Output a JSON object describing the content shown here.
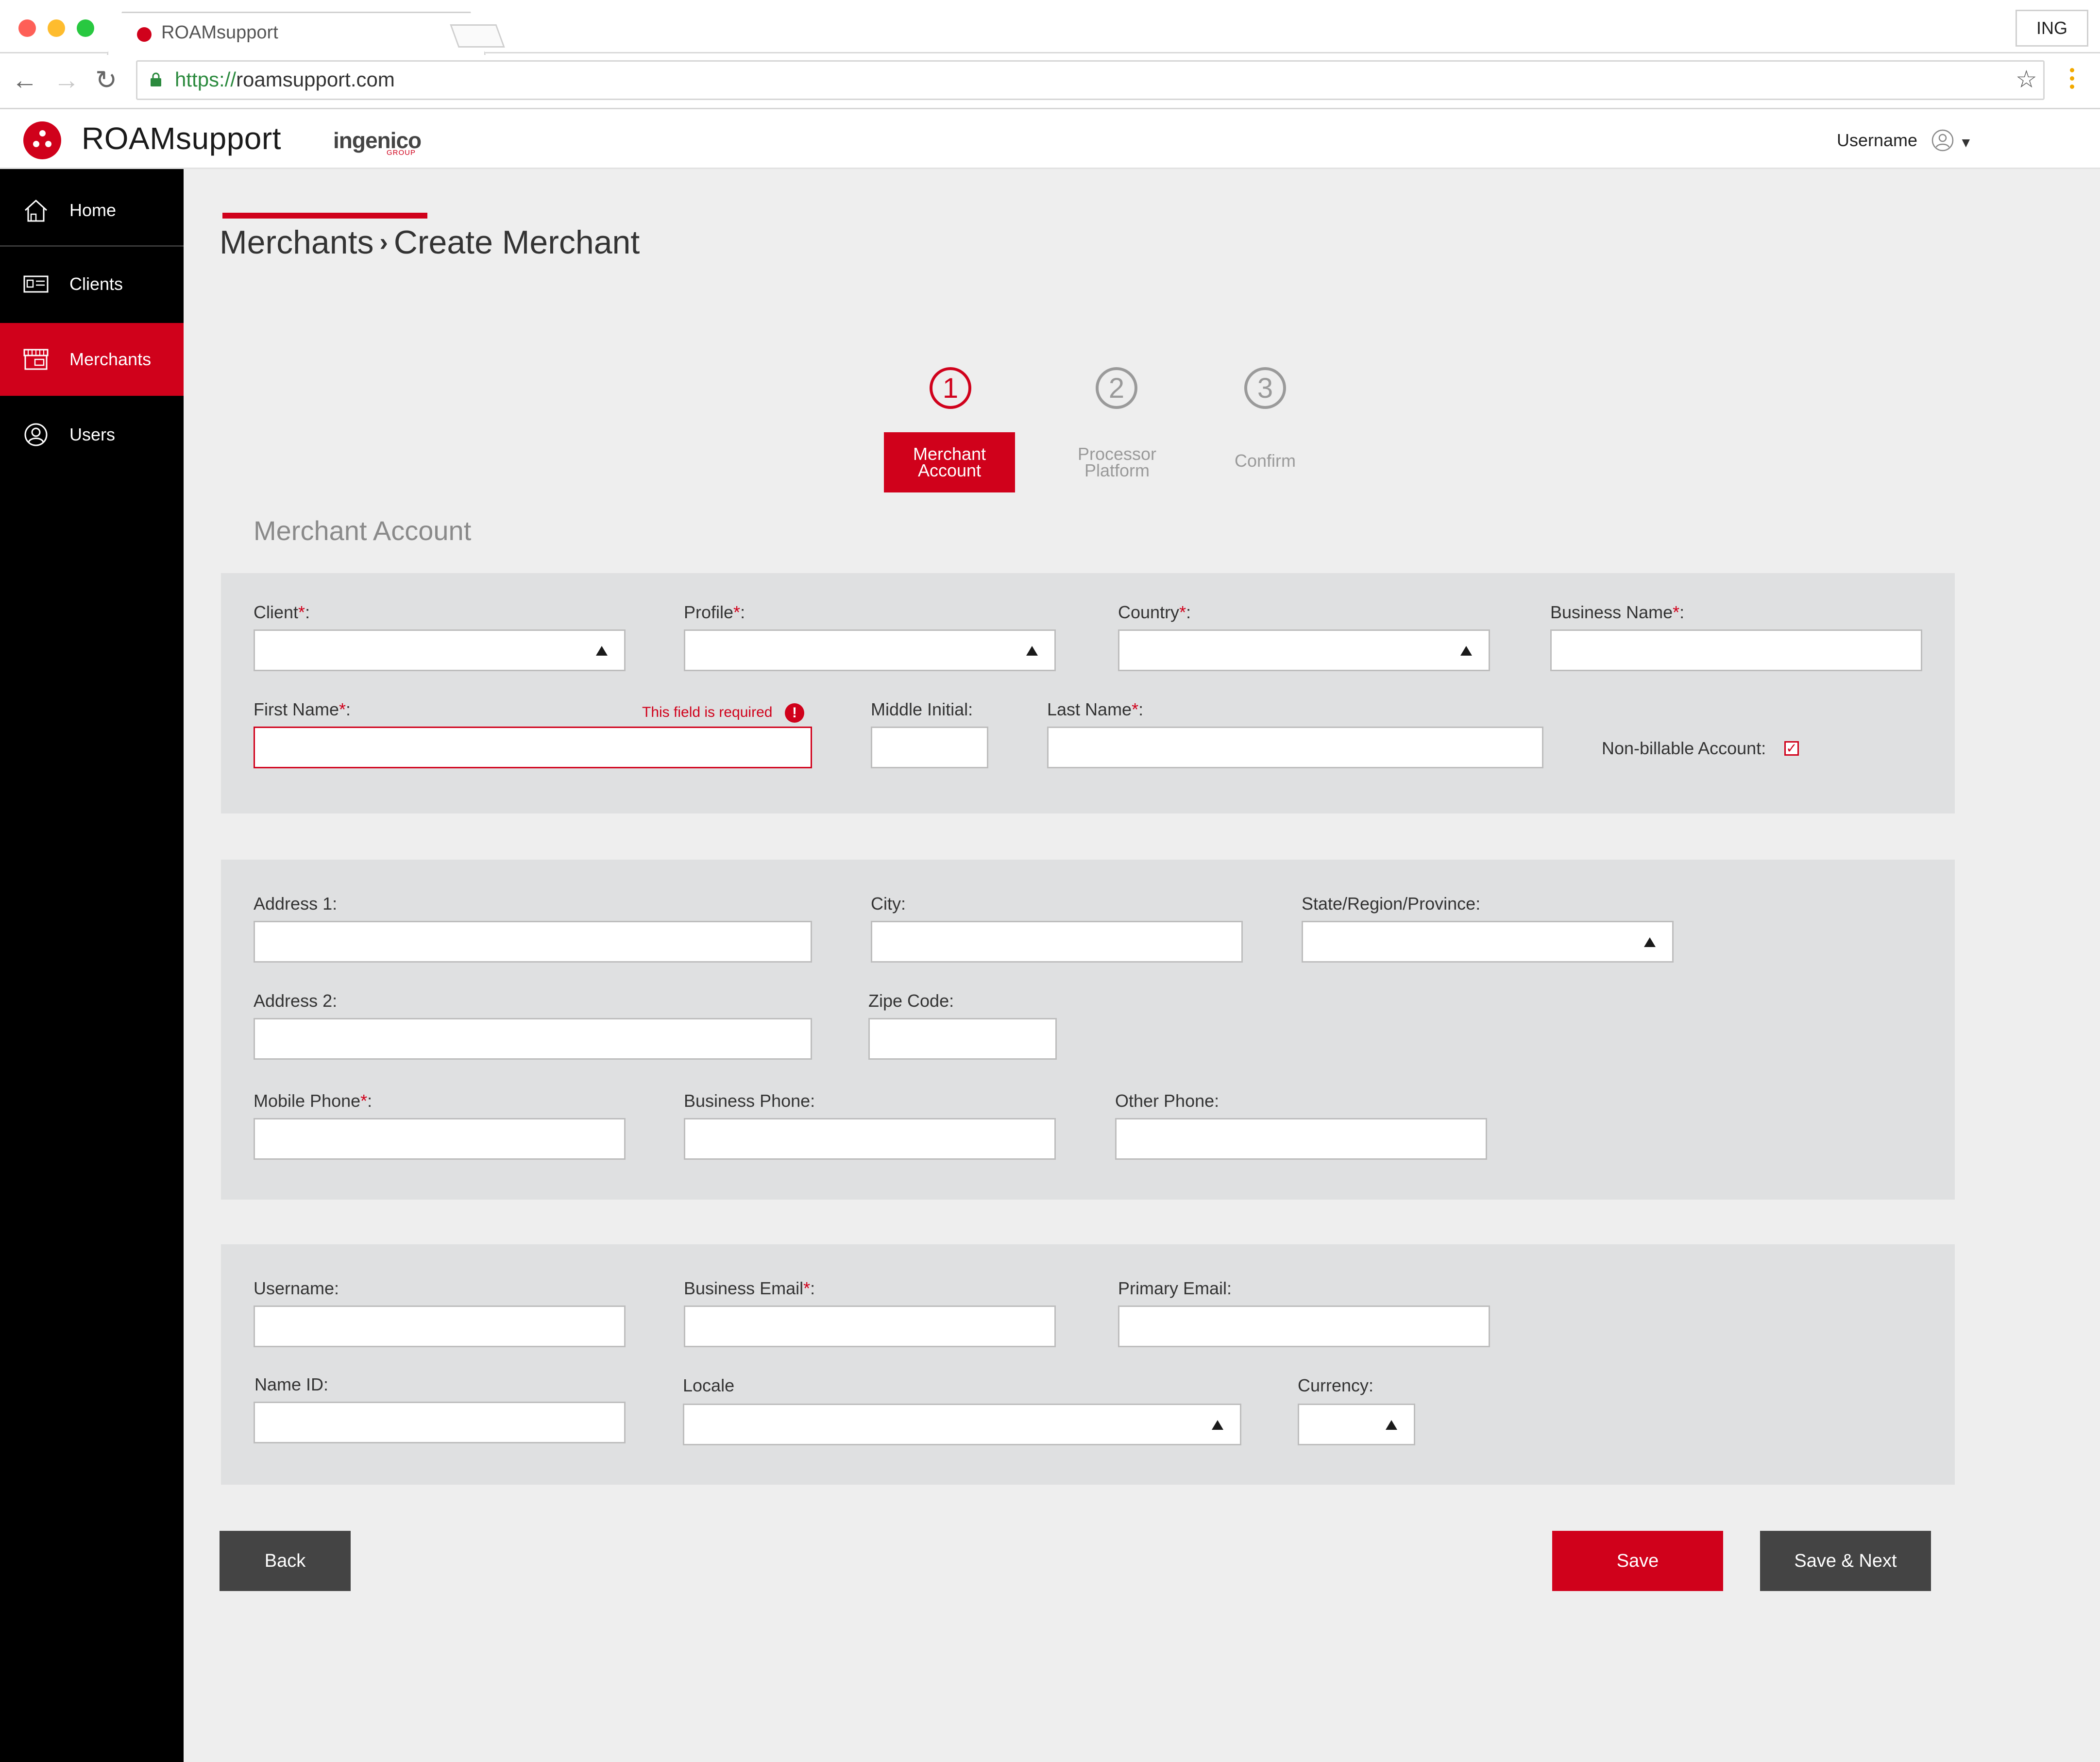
{
  "browser": {
    "tab_title": "ROAMsupport",
    "url_scheme": "https://",
    "url_host": "roamsupport.com",
    "profile_button": "ING"
  },
  "header": {
    "brand": "ROAMsupport",
    "partner_logo": "ingenico",
    "partner_logo_sub": "GROUP",
    "username": "Username"
  },
  "sidebar": {
    "items": [
      {
        "label": "Home",
        "icon": "home-icon"
      },
      {
        "label": "Clients",
        "icon": "id-card-icon"
      },
      {
        "label": "Merchants",
        "icon": "storefront-icon",
        "active": true
      },
      {
        "label": "Users",
        "icon": "user-icon"
      }
    ]
  },
  "breadcrumb": {
    "parent": "Merchants",
    "separator": "›",
    "current": "Create Merchant"
  },
  "steps": [
    {
      "number": "1",
      "label_line1": "Merchant",
      "label_line2": "Account",
      "active": true
    },
    {
      "number": "2",
      "label_line1": "Processor",
      "label_line2": "Platform",
      "active": false
    },
    {
      "number": "3",
      "label_line1": "Confirm",
      "label_line2": "",
      "active": false
    }
  ],
  "section_title": "Merchant Account",
  "form": {
    "client": {
      "label": "Client",
      "value": ""
    },
    "profile": {
      "label": "Profile",
      "value": ""
    },
    "country": {
      "label": "Country",
      "value": ""
    },
    "business_name": {
      "label": "Business Name",
      "value": ""
    },
    "first_name": {
      "label": "First Name",
      "value": "",
      "error": "This field is required"
    },
    "middle_initial": {
      "label": "Middle Initial:",
      "value": ""
    },
    "last_name": {
      "label": "Last Name",
      "value": ""
    },
    "non_billable": {
      "label": "Non-billable Account:",
      "checked": true
    },
    "address1": {
      "label": "Address 1:",
      "value": ""
    },
    "city": {
      "label": "City:",
      "value": ""
    },
    "state": {
      "label": "State/Region/Province:",
      "value": ""
    },
    "address2": {
      "label": "Address 2:",
      "value": ""
    },
    "zip": {
      "label": "Zipe Code:",
      "value": ""
    },
    "mobile_phone": {
      "label": "Mobile Phone",
      "value": ""
    },
    "business_phone": {
      "label": "Business Phone:",
      "value": ""
    },
    "other_phone": {
      "label": "Other Phone:",
      "value": ""
    },
    "username": {
      "label": "Username:",
      "value": ""
    },
    "business_email": {
      "label": "Business Email",
      "value": ""
    },
    "primary_email": {
      "label": "Primary Email:",
      "value": ""
    },
    "name_id": {
      "label": "Name ID:",
      "value": ""
    },
    "locale": {
      "label": "Locale",
      "value": ""
    },
    "currency": {
      "label": "Currency:",
      "value": ""
    }
  },
  "required_mark": "*",
  "label_colon": ":",
  "buttons": {
    "back": "Back",
    "save": "Save",
    "save_next": "Save & Next"
  },
  "colors": {
    "accent": "#d0011b",
    "sidebar_bg": "#000000",
    "panel_bg": "#dfe0e1",
    "page_bg": "#eeeeee",
    "dark_button": "#444444"
  }
}
